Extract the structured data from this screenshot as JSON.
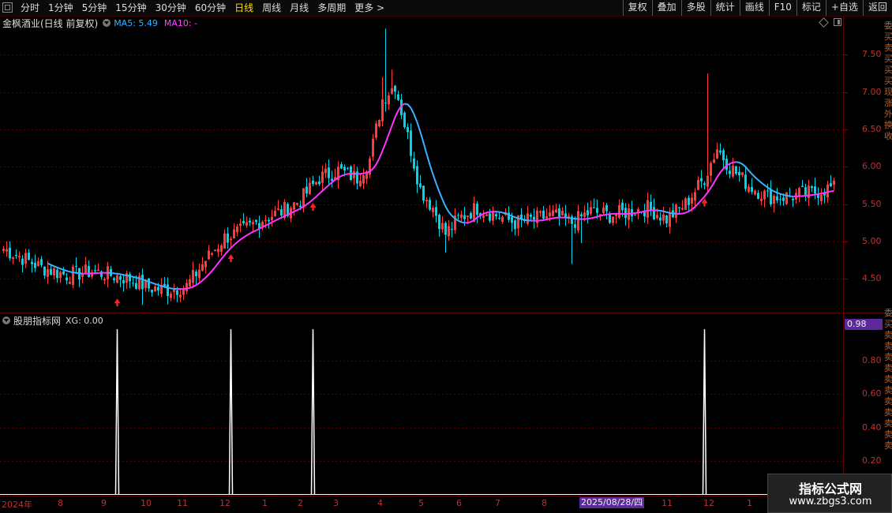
{
  "toolbar": {
    "periods": [
      "分时",
      "1分钟",
      "5分钟",
      "15分钟",
      "30分钟",
      "60分钟",
      "日线",
      "周线",
      "月线",
      "多周期",
      "更多 >"
    ],
    "active_period": "日线",
    "right_buttons": [
      "复权",
      "叠加",
      "多股",
      "统计",
      "画线",
      "F10",
      "标记",
      "+自选",
      "返回"
    ]
  },
  "main_chart": {
    "stock_name": "金枫酒业(日线 前复权)",
    "ma5_label": "MA5: 5.49",
    "ma10_label": "MA10: -",
    "price_axis": [
      "7.50",
      "7.00",
      "6.50",
      "6.00",
      "5.50",
      "5.00",
      "4.50"
    ],
    "colors": {
      "up": "#ff3b3b",
      "down": "#00d4e8",
      "ma5": "#3ab0ff",
      "ma10": "#ff33ff",
      "arrow": "#ff2020",
      "grid": "#5a0000"
    }
  },
  "sub_chart": {
    "name": "股朋指标网",
    "xg_label": "XG: 0.00",
    "current_value": "0.98",
    "axis": [
      "0.80",
      "0.60",
      "0.40",
      "0.20"
    ]
  },
  "date_axis": {
    "labels": [
      "2024年",
      "8",
      "9",
      "10",
      "11",
      "12",
      "1",
      "2",
      "3",
      "4",
      "5",
      "6",
      "7",
      "8",
      "11",
      "12",
      "1"
    ],
    "cursor_date": "2025/08/28/四"
  },
  "right_strip_chars": [
    "委",
    "买",
    "卖",
    "买",
    "买",
    "买",
    "现",
    "涨",
    "外",
    "换",
    "收",
    "委",
    "买",
    "卖",
    "卖",
    "卖",
    "卖",
    "卖",
    "卖",
    "卖",
    "卖",
    "卖",
    "卖",
    "卖"
  ],
  "watermark": {
    "title": "指标公式网",
    "url": "www.zbgs3.com"
  },
  "chart_data": {
    "type": "candlestick",
    "ylim": [
      4.05,
      8.0
    ],
    "signals_at_index": [
      36,
      72,
      98,
      222
    ],
    "xg_values_note": "spikes to 1 at signal indices, 0 elsewhere"
  }
}
